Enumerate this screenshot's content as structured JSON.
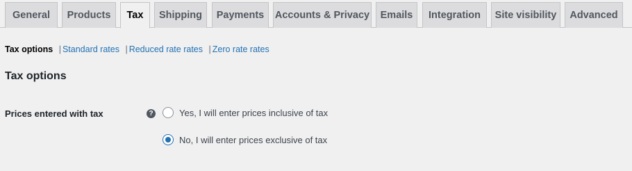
{
  "tabs": [
    {
      "label": "General",
      "active": false
    },
    {
      "label": "Products",
      "active": false
    },
    {
      "label": "Tax",
      "active": true
    },
    {
      "label": "Shipping",
      "active": false
    },
    {
      "label": "Payments",
      "active": false
    },
    {
      "label": "Accounts & Privacy",
      "active": false
    },
    {
      "label": "Emails",
      "active": false
    },
    {
      "label": "Integration",
      "active": false
    },
    {
      "label": "Site visibility",
      "active": false
    },
    {
      "label": "Advanced",
      "active": false
    }
  ],
  "subnav": {
    "current": "Tax options",
    "links": [
      "Standard rates",
      "Reduced rate rates",
      "Zero rate rates"
    ]
  },
  "section_title": "Tax options",
  "field": {
    "label": "Prices entered with tax",
    "help_icon": "question-mark-icon",
    "options": [
      {
        "label": "Yes, I will enter prices inclusive of tax",
        "checked": false
      },
      {
        "label": "No, I will enter prices exclusive of tax",
        "checked": true
      }
    ]
  },
  "colors": {
    "accent": "#2271b1",
    "background": "#f0f0f1",
    "tab_inactive": "#dcdcde"
  }
}
